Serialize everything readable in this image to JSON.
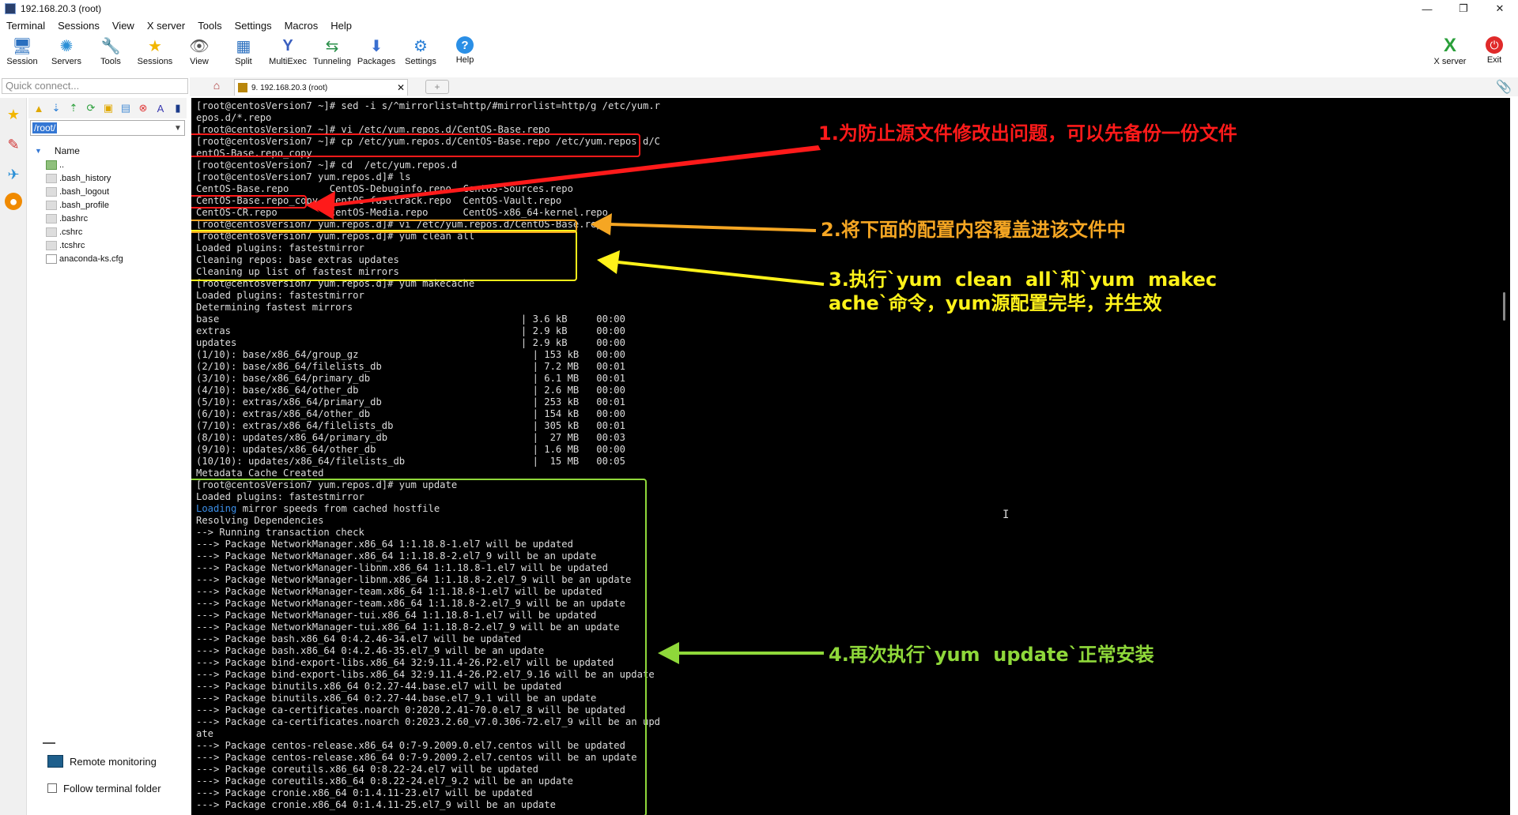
{
  "window": {
    "title": "192.168.20.3 (root)",
    "controls": [
      "—",
      "❐",
      "✕"
    ]
  },
  "menu": [
    "Terminal",
    "Sessions",
    "View",
    "X server",
    "Tools",
    "Settings",
    "Macros",
    "Help"
  ],
  "toolbar": {
    "left": [
      {
        "label": "Session",
        "icon": "session-icon",
        "glyph": "🖥"
      },
      {
        "label": "Servers",
        "icon": "servers-icon",
        "glyph": "✺"
      },
      {
        "label": "Tools",
        "icon": "tools-icon",
        "glyph": "🔧"
      },
      {
        "label": "Sessions",
        "icon": "star-icon",
        "glyph": "★"
      },
      {
        "label": "View",
        "icon": "view-icon",
        "glyph": "👁"
      },
      {
        "label": "Split",
        "icon": "split-icon",
        "glyph": "▦"
      },
      {
        "label": "MultiExec",
        "icon": "multiexec-icon",
        "glyph": "Y"
      },
      {
        "label": "Tunneling",
        "icon": "tunneling-icon",
        "glyph": "⇆"
      },
      {
        "label": "Packages",
        "icon": "packages-icon",
        "glyph": "⬇"
      },
      {
        "label": "Settings",
        "icon": "settings-icon",
        "glyph": "⚙"
      },
      {
        "label": "Help",
        "icon": "help-icon",
        "glyph": "?"
      }
    ],
    "right": [
      {
        "label": "X server",
        "icon": "x-server-icon",
        "glyph": "X"
      },
      {
        "label": "Exit",
        "icon": "exit-icon",
        "glyph": "⏻"
      }
    ]
  },
  "quick_connect": {
    "placeholder": "Quick connect..."
  },
  "tabs": {
    "active_label": "9. 192.168.20.3 (root)",
    "close": "✕",
    "add": "+"
  },
  "sftp": {
    "path": "/root/",
    "column": "Name",
    "files": [
      "..",
      ".bash_history",
      ".bash_logout",
      ".bash_profile",
      ".bashrc",
      ".cshrc",
      ".tcshrc",
      "anaconda-ks.cfg"
    ],
    "remote_monitoring": "Remote monitoring",
    "follow_folder": "Follow terminal folder"
  },
  "terminal_lines": [
    "[root@centosVersion7 ~]# sed -i s/^mirrorlist=http/#mirrorlist=http/g /etc/yum.r",
    "epos.d/*.repo",
    "[root@centosVersion7 ~]# vi /etc/yum.repos.d/CentOS-Base.repo",
    "[root@centosVersion7 ~]# cp /etc/yum.repos.d/CentOS-Base.repo /etc/yum.repos.d/C",
    "entOS-Base.repo_copy",
    "[root@centosVersion7 ~]# cd  /etc/yum.repos.d",
    "[root@centosVersion7 yum.repos.d]# ls",
    "CentOS-Base.repo       CentOS-Debuginfo.repo  CentOS-Sources.repo",
    "CentOS-Base.repo_copy  CentOS-fasttrack.repo  CentOS-Vault.repo",
    "CentOS-CR.repo         CentOS-Media.repo      CentOS-x86_64-kernel.repo",
    "[root@centosVersion7 yum.repos.d]# vi /etc/yum.repos.d/CentOS-Base.repo",
    "[root@centosVersion7 yum.repos.d]# yum clean all",
    "Loaded plugins: fastestmirror",
    "Cleaning repos: base extras updates",
    "Cleaning up list of fastest mirrors",
    "[root@centosVersion7 yum.repos.d]# yum makecache",
    "Loaded plugins: fastestmirror",
    "Determining fastest mirrors",
    "base                                                    | 3.6 kB     00:00",
    "extras                                                  | 2.9 kB     00:00",
    "updates                                                 | 2.9 kB     00:00",
    "(1/10): base/x86_64/group_gz                              | 153 kB   00:00",
    "(2/10): base/x86_64/filelists_db                          | 7.2 MB   00:01",
    "(3/10): base/x86_64/primary_db                            | 6.1 MB   00:01",
    "(4/10): base/x86_64/other_db                              | 2.6 MB   00:00",
    "(5/10): extras/x86_64/primary_db                          | 253 kB   00:01",
    "(6/10): extras/x86_64/other_db                            | 154 kB   00:00",
    "(7/10): extras/x86_64/filelists_db                        | 305 kB   00:01",
    "(8/10): updates/x86_64/primary_db                         |  27 MB   00:03",
    "(9/10): updates/x86_64/other_db                           | 1.6 MB   00:00",
    "(10/10): updates/x86_64/filelists_db                      |  15 MB   00:05",
    "Metadata Cache Created",
    "[root@centosVersion7 yum.repos.d]# yum update",
    "Loaded plugins: fastestmirror",
    "Loading mirror speeds from cached hostfile",
    "Resolving Dependencies",
    "--> Running transaction check",
    "---> Package NetworkManager.x86_64 1:1.18.8-1.el7 will be updated",
    "---> Package NetworkManager.x86_64 1:1.18.8-2.el7_9 will be an update",
    "---> Package NetworkManager-libnm.x86_64 1:1.18.8-1.el7 will be updated",
    "---> Package NetworkManager-libnm.x86_64 1:1.18.8-2.el7_9 will be an update",
    "---> Package NetworkManager-team.x86_64 1:1.18.8-1.el7 will be updated",
    "---> Package NetworkManager-team.x86_64 1:1.18.8-2.el7_9 will be an update",
    "---> Package NetworkManager-tui.x86_64 1:1.18.8-1.el7 will be updated",
    "---> Package NetworkManager-tui.x86_64 1:1.18.8-2.el7_9 will be an update",
    "---> Package bash.x86_64 0:4.2.46-34.el7 will be updated",
    "---> Package bash.x86_64 0:4.2.46-35.el7_9 will be an update",
    "---> Package bind-export-libs.x86_64 32:9.11.4-26.P2.el7 will be updated",
    "---> Package bind-export-libs.x86_64 32:9.11.4-26.P2.el7_9.16 will be an update",
    "---> Package binutils.x86_64 0:2.27-44.base.el7 will be updated",
    "---> Package binutils.x86_64 0:2.27-44.base.el7_9.1 will be an update",
    "---> Package ca-certificates.noarch 0:2020.2.41-70.0.el7_8 will be updated",
    "---> Package ca-certificates.noarch 0:2023.2.60_v7.0.306-72.el7_9 will be an upd",
    "ate",
    "---> Package centos-release.x86_64 0:7-9.2009.0.el7.centos will be updated",
    "---> Package centos-release.x86_64 0:7-9.2009.2.el7.centos will be an update",
    "---> Package coreutils.x86_64 0:8.22-24.el7 will be updated",
    "---> Package coreutils.x86_64 0:8.22-24.el7_9.2 will be an update",
    "---> Package cronie.x86_64 0:1.4.11-23.el7 will be updated",
    "---> Package cronie.x86_64 0:1.4.11-25.el7_9 will be an update"
  ],
  "loading_word": "Loading",
  "annotations": {
    "a1": "1.为防止源文件修改出问题，可以先备份一份文件",
    "a2": "2.将下面的配置内容覆盖进该文件中",
    "a3": "3.执行`yum  clean  all`和`yum  makec\nache`命令，yum源配置完毕，并生效",
    "a4": "4.再次执行`yum  update`正常安装"
  },
  "colors": {
    "red": "#ff1a1a",
    "orange": "#f5a623",
    "yellow": "#fff21a",
    "green": "#8fd83a",
    "accent": "#3477d4"
  }
}
